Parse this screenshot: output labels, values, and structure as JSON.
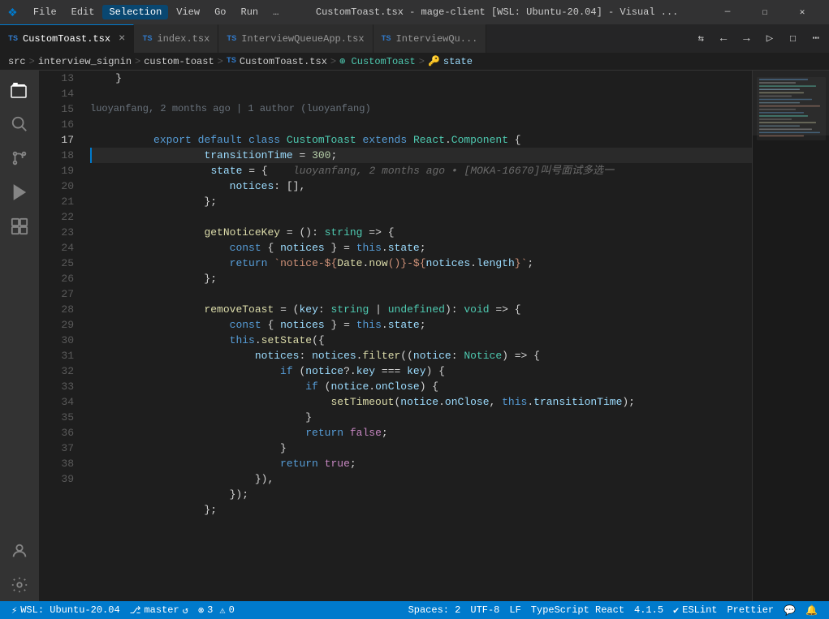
{
  "titlebar": {
    "logo": "VS",
    "menus": [
      "File",
      "Edit",
      "Selection",
      "View",
      "Go",
      "Run",
      "…"
    ],
    "active_menu": "Selection",
    "title": "CustomToast.tsx - mage-client [WSL: Ubuntu-20.04] - Visual ...",
    "window_buttons": [
      "—",
      "☐",
      "✕"
    ]
  },
  "tabs": [
    {
      "id": "custom-toast",
      "icon": "TS",
      "label": "CustomToast.tsx",
      "active": true,
      "closeable": true
    },
    {
      "id": "index",
      "icon": "TS",
      "label": "index.tsx",
      "active": false,
      "closeable": false
    },
    {
      "id": "interview-queue-app",
      "icon": "TS",
      "label": "InterviewQueueApp.tsx",
      "active": false,
      "closeable": false
    },
    {
      "id": "interview-qu",
      "icon": "TS",
      "label": "InterviewQu...",
      "active": false,
      "closeable": false
    }
  ],
  "breadcrumb": {
    "parts": [
      "src",
      "interview_signin",
      "custom-toast",
      "TS CustomToast.tsx",
      "⊕ CustomToast",
      "🔑 state"
    ]
  },
  "activity_icons": [
    "explorer",
    "search",
    "source-control",
    "run-debug",
    "extensions",
    "account",
    "settings"
  ],
  "code": {
    "git_blame": "luoyanfang, 2 months ago | 1 author (luoyanfang)",
    "inline_annotation": "luoyanfang, 2 months ago • [MOKA-16670]叫号面试多选一",
    "lines": [
      {
        "n": 13,
        "content": "    }"
      },
      {
        "n": 14,
        "content": ""
      },
      {
        "n": 15,
        "content": "    export default class CustomToast extends React.Component {",
        "highlighted": false
      },
      {
        "n": 16,
        "content": "        transitionTime = 300;"
      },
      {
        "n": 17,
        "content": "        state = {",
        "current": true
      },
      {
        "n": 18,
        "content": "            notices: [],"
      },
      {
        "n": 19,
        "content": "        };"
      },
      {
        "n": 20,
        "content": ""
      },
      {
        "n": 21,
        "content": "        getNoticeKey = (): string => {"
      },
      {
        "n": 22,
        "content": "            const { notices } = this.state;"
      },
      {
        "n": 23,
        "content": "            return `notice-${Date.now()}-${notices.length}`;"
      },
      {
        "n": 24,
        "content": "        };"
      },
      {
        "n": 25,
        "content": ""
      },
      {
        "n": 26,
        "content": "        removeToast = (key: string | undefined): void => {"
      },
      {
        "n": 27,
        "content": "            const { notices } = this.state;"
      },
      {
        "n": 28,
        "content": "            this.setState({"
      },
      {
        "n": 29,
        "content": "                notices: notices.filter((notice: Notice) => {"
      },
      {
        "n": 30,
        "content": "                    if (notice?.key === key) {"
      },
      {
        "n": 31,
        "content": "                        if (notice.onClose) {"
      },
      {
        "n": 32,
        "content": "                            setTimeout(notice.onClose, this.transitionTime);"
      },
      {
        "n": 33,
        "content": "                        }"
      },
      {
        "n": 34,
        "content": "                        return false;"
      },
      {
        "n": 35,
        "content": "                    }"
      },
      {
        "n": 36,
        "content": "                    return true;"
      },
      {
        "n": 37,
        "content": "                }),"
      },
      {
        "n": 38,
        "content": "            });"
      },
      {
        "n": 39,
        "content": "        };"
      }
    ]
  },
  "statusbar": {
    "wsl": "WSL: Ubuntu-20.04",
    "branch_icon": "⎇",
    "branch": "master",
    "sync_icon": "↺",
    "errors": "3",
    "warnings": "0",
    "spaces_label": "Spaces: 2",
    "encoding": "UTF-8",
    "line_ending": "LF",
    "language": "TypeScript React",
    "version": "4.1.5",
    "eslint": "ESLint",
    "prettier": "Prettier",
    "notifications_icon": "🔔",
    "remote_icon": "⚡"
  }
}
